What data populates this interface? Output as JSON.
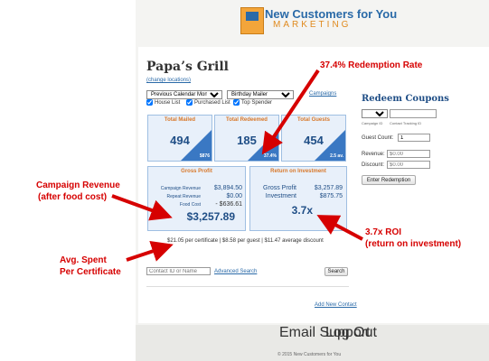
{
  "logo": {
    "title": "New Customers for You",
    "subtitle": "MARKETING"
  },
  "restaurant": {
    "name": "Papa’s Grill",
    "change_locations": "(change locations)"
  },
  "filters": {
    "period": "Previous Calendar Month",
    "mailer": "Birthday Mailer",
    "campaigns_link": "Campaigns",
    "house_list": "House List",
    "purchased_list": "Purchased List",
    "top_spender": "Top Spender"
  },
  "tiles": {
    "total_mailed": {
      "label": "Total Mailed",
      "value": "494",
      "badge": "$876"
    },
    "total_redeemed": {
      "label": "Total Redeemed",
      "value": "185",
      "badge": "37.4%"
    },
    "total_guests": {
      "label": "Total Guests",
      "value": "454",
      "badge": "2.5 av."
    }
  },
  "gross_profit": {
    "label": "Gross Profit",
    "campaign_revenue_label": "Campaign Revenue",
    "campaign_revenue": "$3,894.50",
    "repeat_revenue_label": "Repeat Revenue",
    "repeat_revenue": "$0.00",
    "food_cost_label": "Food Cost",
    "food_cost": "- $636.61",
    "total": "$3,257.89"
  },
  "roi": {
    "label": "Return on Investment",
    "gross_profit_label": "Gross Profit",
    "gross_profit": "$3,257.89",
    "investment_label": "Investment",
    "investment": "$875.75",
    "ratio": "3.7x"
  },
  "summary": "$21.05 per certificate | $8.58 per guest | $11.47 average discount",
  "search": {
    "placeholder": "Contact ID or Name",
    "advanced": "Advanced Search",
    "button": "Search"
  },
  "add_contact": "Add New Contact",
  "redeem": {
    "title": "Redeem Coupons",
    "campaign_id_label": "Campaign ID",
    "contact_tracking_label": "Contact Tracking ID",
    "guest_count_label": "Guest Count:",
    "guest_count": "1",
    "revenue_label": "Revenue:",
    "revenue_placeholder": "$0.00",
    "discount_label": "Discount:",
    "discount_placeholder": "$0.00",
    "button": "Enter Redemption"
  },
  "footer": {
    "email_support": "Email Support",
    "log_out": "Log Out",
    "copyright": "© 2015 New Customers for You"
  },
  "annotations": {
    "redemption_rate": "37.4% Redemption Rate",
    "campaign_revenue_line1": "Campaign Revenue",
    "campaign_revenue_line2": "(after food cost)",
    "roi_line1": "3.7x ROI",
    "roi_line2": "(return on investment)",
    "avg_spent_line1": "Avg. Spent",
    "avg_spent_line2": "Per Certificate"
  },
  "colors": {
    "accent_blue": "#1f4e86",
    "tile_orange": "#d8782a",
    "annotation_red": "#d60000"
  }
}
